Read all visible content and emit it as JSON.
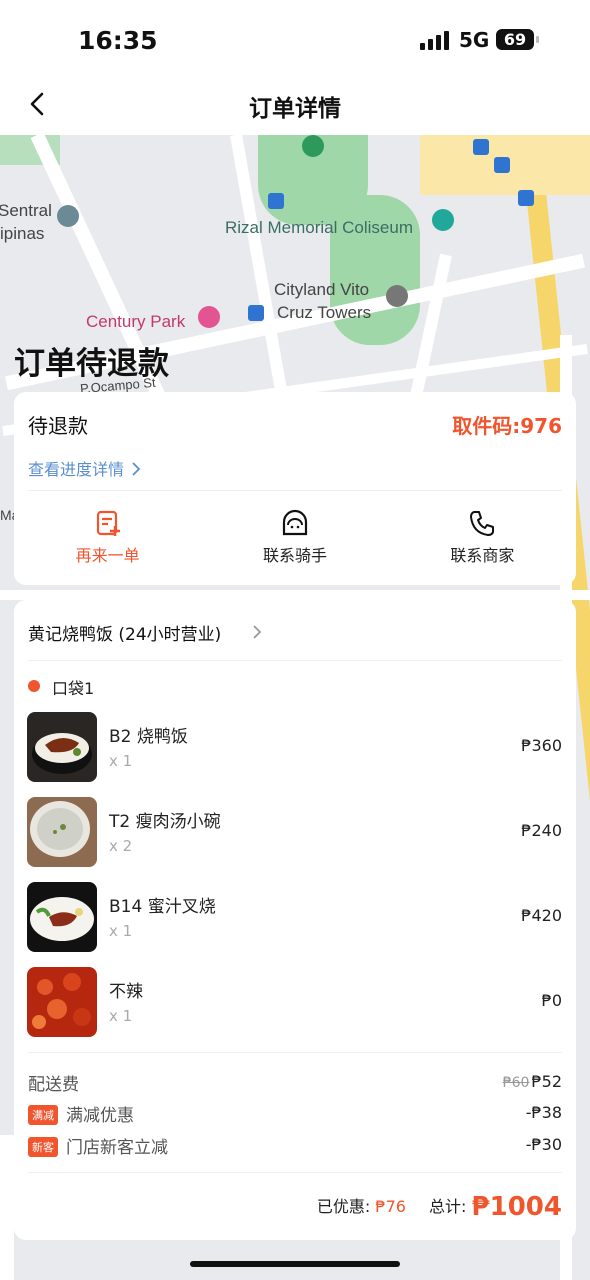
{
  "status_bar": {
    "time": "16:35",
    "network": "5G",
    "battery": "69"
  },
  "nav": {
    "title": "订单详情"
  },
  "map": {
    "labels": {
      "sentral": "Sentral",
      "ipinas": "ipinas",
      "rizal": "Rizal Memorial Coliseum",
      "cityland1": "Cityland Vito",
      "cityland2": "Cruz Towers",
      "century": "Century Park",
      "pocampo": "P.Ocampo St",
      "ma": "Ma"
    }
  },
  "order": {
    "headline": "订单待退款",
    "status": "待退款",
    "pickup_code": "取件码:976",
    "progress_link": "查看进度详情",
    "actions": [
      {
        "label": "再来一单",
        "icon": "reorder-icon"
      },
      {
        "label": "联系骑手",
        "icon": "rider-icon"
      },
      {
        "label": "联系商家",
        "icon": "phone-icon"
      }
    ]
  },
  "store": {
    "name": "黄记烧鸭饭 (24小时营业)",
    "bag": "口袋1",
    "items": [
      {
        "name": "B2 烧鸭饭",
        "qty": "x 1",
        "price": "₱360"
      },
      {
        "name": "T2 瘦肉汤小碗",
        "qty": "x 2",
        "price": "₱240"
      },
      {
        "name": "B14 蜜汁叉烧",
        "qty": "x 1",
        "price": "₱420"
      },
      {
        "name": "不辣",
        "qty": "x 1",
        "price": "₱0"
      }
    ]
  },
  "fees": {
    "delivery_label": "配送费",
    "delivery_original": "₱60",
    "delivery_price": "₱52",
    "promo1_tag": "满减",
    "promo1_label": "满减优惠",
    "promo1_value": "-₱38",
    "promo2_tag": "新客",
    "promo2_label": "门店新客立减",
    "promo2_value": "-₱30"
  },
  "totals": {
    "discount_label": "已优惠:",
    "discount_value": "₱76",
    "total_label": "总计:",
    "total_value": "₱1004"
  },
  "colors": {
    "accent": "#f0552e",
    "link": "#5a8fd0"
  }
}
